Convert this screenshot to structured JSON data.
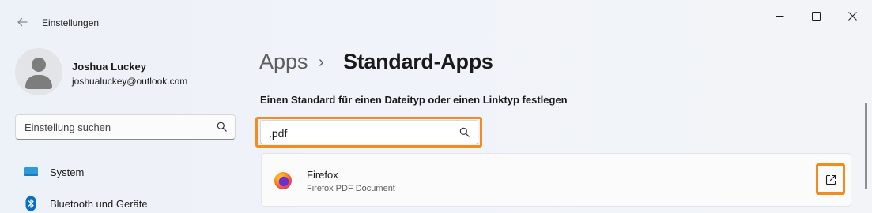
{
  "window": {
    "title": "Einstellungen",
    "icons": {
      "back": "arrow-left-icon",
      "minimize": "minimize-icon",
      "maximize": "maximize-icon",
      "close": "close-icon"
    }
  },
  "sidebar": {
    "user": {
      "name": "Joshua Luckey",
      "email": "joshualuckey@outlook.com"
    },
    "search": {
      "placeholder": "Einstellung suchen",
      "icon": "search-icon"
    },
    "items": [
      {
        "label": "System",
        "icon": "monitor-icon"
      },
      {
        "label": "Bluetooth und Geräte",
        "icon": "bluetooth-icon"
      }
    ]
  },
  "main": {
    "breadcrumb": {
      "parent": "Apps",
      "separator": "›",
      "current": "Standard-Apps"
    },
    "section_title": "Einen Standard für einen Dateityp oder einen Linktyp festlegen",
    "search": {
      "value": ".pdf",
      "icon": "search-icon"
    },
    "result": {
      "app_name": "Firefox",
      "file_type": "Firefox PDF Document",
      "icon": "firefox-icon",
      "action_icon": "open-external-icon"
    }
  },
  "colors": {
    "highlight": "#f28c1e",
    "accent": "#0067c0"
  }
}
